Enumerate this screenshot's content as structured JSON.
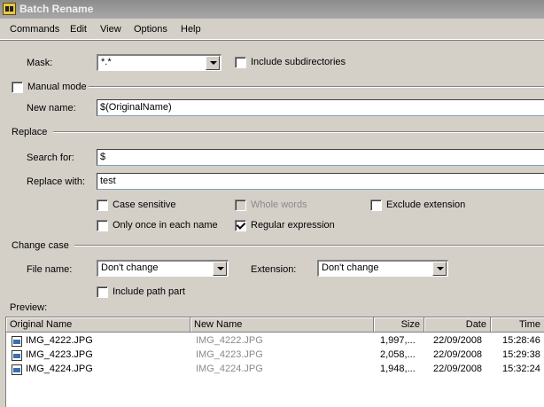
{
  "window": {
    "title": "Batch Rename"
  },
  "menu": [
    "Commands",
    "Edit",
    "View",
    "Options",
    "Help"
  ],
  "mask": {
    "label": "Mask:",
    "value": "*.*",
    "include_subdirs_label": "Include subdirectories",
    "include_subdirs": false
  },
  "manual_mode": {
    "label": "Manual mode",
    "checked": false
  },
  "new_name": {
    "label": "New name:",
    "value": "$(OriginalName)"
  },
  "replace": {
    "group_label": "Replace",
    "search_label": "Search for:",
    "search_value": "$",
    "replace_label": "Replace with:",
    "replace_value": "test",
    "case_sensitive_label": "Case sensitive",
    "whole_words_label": "Whole words",
    "exclude_extension_label": "Exclude extension",
    "only_once_label": "Only once in each name",
    "regex_label": "Regular expression",
    "regex_checked": true
  },
  "change_case": {
    "group_label": "Change case",
    "file_name_label": "File name:",
    "file_name_value": "Don't change",
    "extension_label": "Extension:",
    "extension_value": "Don't change",
    "include_path_label": "Include path part"
  },
  "preview": {
    "label": "Preview:",
    "columns": [
      "Original Name",
      "New Name",
      "Size",
      "Date",
      "Time"
    ],
    "rows": [
      {
        "original": "IMG_4222.JPG",
        "new": "IMG_4222.JPG",
        "size": "1,997,...",
        "date": "22/09/2008",
        "time": "15:28:46"
      },
      {
        "original": "IMG_4223.JPG",
        "new": "IMG_4223.JPG",
        "size": "2,058,...",
        "date": "22/09/2008",
        "time": "15:29:38"
      },
      {
        "original": "IMG_4224.JPG",
        "new": "IMG_4224.JPG",
        "size": "1,948,...",
        "date": "22/09/2008",
        "time": "15:32:24"
      }
    ]
  }
}
